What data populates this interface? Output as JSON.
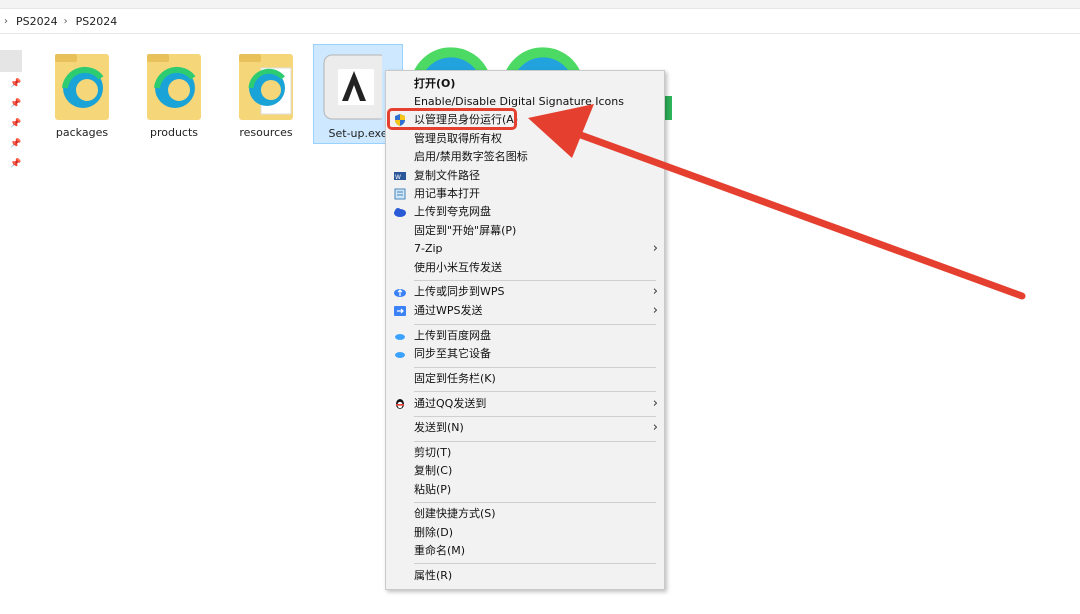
{
  "breadcrumb": {
    "items": [
      "PS2024",
      "PS2024"
    ]
  },
  "files": [
    {
      "label": "packages"
    },
    {
      "label": "products"
    },
    {
      "label": "resources"
    },
    {
      "label": "Set-up.exe"
    }
  ],
  "menu": {
    "items": [
      {
        "label": "打开(O)",
        "icon": ""
      },
      {
        "label": "Enable/Disable Digital Signature Icons",
        "icon": ""
      },
      {
        "label": "以管理员身份运行(A)",
        "icon": "uac-shield-icon"
      },
      {
        "label": "管理员取得所有权",
        "icon": ""
      },
      {
        "label": "启用/禁用数字签名图标",
        "icon": ""
      },
      {
        "label": "复制文件路径",
        "icon": "word-icon"
      },
      {
        "label": "用记事本打开",
        "icon": "notepad-icon"
      },
      {
        "label": "上传到夸克网盘",
        "icon": "quark-cloud-icon"
      },
      {
        "label": "固定到\"开始\"屏幕(P)",
        "icon": ""
      },
      {
        "label": "7-Zip",
        "icon": ""
      },
      {
        "label": "使用小米互传发送",
        "icon": ""
      },
      {
        "label": "上传或同步到WPS",
        "icon": "wps-cloud-icon"
      },
      {
        "label": "通过WPS发送",
        "icon": "wps-send-icon"
      },
      {
        "label": "上传到百度网盘",
        "icon": "baidu-cloud-icon"
      },
      {
        "label": "同步至其它设备",
        "icon": "baidu-sync-icon"
      },
      {
        "label": "固定到任务栏(K)",
        "icon": ""
      },
      {
        "label": "通过QQ发送到",
        "icon": "qq-penguin-icon"
      },
      {
        "label": "发送到(N)",
        "icon": ""
      },
      {
        "label": "剪切(T)",
        "icon": ""
      },
      {
        "label": "复制(C)",
        "icon": ""
      },
      {
        "label": "粘贴(P)",
        "icon": ""
      },
      {
        "label": "创建快捷方式(S)",
        "icon": ""
      },
      {
        "label": "删除(D)",
        "icon": ""
      },
      {
        "label": "重命名(M)",
        "icon": ""
      },
      {
        "label": "属性(R)",
        "icon": ""
      }
    ]
  },
  "colors": {
    "highlight": "#e5402f",
    "selection": "#cde8ff",
    "menu_bg": "#f2f2f2"
  }
}
